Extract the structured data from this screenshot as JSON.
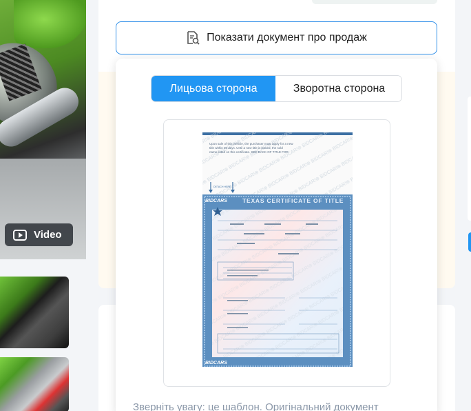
{
  "gallery": {
    "video_label": "Video"
  },
  "document_panel": {
    "toggle_button_label": "Показати документ про продаж",
    "tabs": [
      {
        "label": "Лицьова сторона",
        "active": true
      },
      {
        "label": "Зворотна сторона",
        "active": false
      }
    ],
    "notice_text": "Зверніть увагу: це шаблон. Оригінальний документ",
    "document": {
      "intro_text": [
        "Upon sale of this vehicle, the purchaser must apply for a new",
        "title within 30 days. Until a new title is issued, the sold",
        "name listed on this certificate. SEE BACK OF TITLE FOR"
      ],
      "title": "TEXAS CERTIFICATE OF TITLE",
      "watermark": "BIDCARS",
      "detach_label": "DETACH HERE"
    }
  },
  "colors": {
    "accent": "#2196f3",
    "border_accent": "#2f8fe8",
    "certificate_blue": "#4f86b8"
  },
  "icons": {
    "video": "play-icon",
    "document": "document-search-icon"
  }
}
